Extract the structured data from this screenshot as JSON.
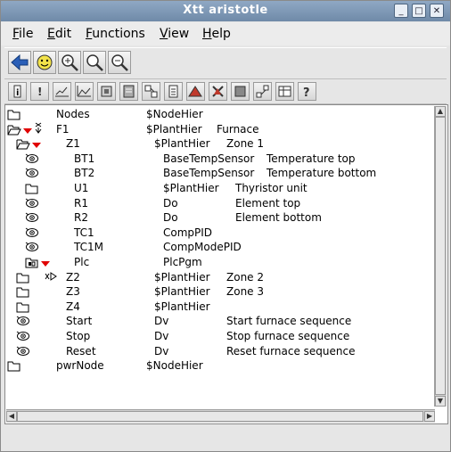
{
  "window": {
    "title": "Xtt aristotle"
  },
  "titlebar_buttons": [
    "minimize-icon",
    "maximize-icon",
    "close-icon"
  ],
  "menu": [
    {
      "label": "File",
      "mnemonic": "F",
      "rest": "ile"
    },
    {
      "label": "Edit",
      "mnemonic": "E",
      "rest": "dit"
    },
    {
      "label": "Functions",
      "mnemonic": "F",
      "rest": "unctions"
    },
    {
      "label": "View",
      "mnemonic": "V",
      "rest": "iew"
    },
    {
      "label": "Help",
      "mnemonic": "H",
      "rest": "elp"
    }
  ],
  "toolbar1": [
    "back-arrow-icon",
    "smiley-icon",
    "zoom-in-icon",
    "zoom-reset-icon",
    "zoom-out-icon"
  ],
  "toolbar2": [
    "info-icon",
    "alarm-icon",
    "trend-icon",
    "graph-icon",
    "object-graph-icon",
    "datasheet-icon",
    "crossref-icon",
    "document-icon",
    "triangle-icon",
    "block-icon",
    "collapse-icon",
    "hierarchy-icon",
    "table-icon",
    "help-icon"
  ],
  "colors": {
    "marker": "#e00000",
    "folder": "#000000",
    "titlebar": "#7b94b2"
  },
  "tree": [
    {
      "name": "Nodes",
      "class": "$NodeHier",
      "desc": "",
      "icon": "folder",
      "marker": false
    },
    {
      "name": "F1",
      "class": "$PlantHier",
      "desc": "Furnace",
      "icon": "folder-open",
      "marker": true
    },
    {
      "name": "Z1",
      "class": "$PlantHier",
      "desc": "Zone 1",
      "icon": "folder-open",
      "marker": true
    },
    {
      "name": "BT1",
      "class": "BaseTempSensor",
      "desc": "Temperature top",
      "icon": "object",
      "marker": false
    },
    {
      "name": "BT2",
      "class": "BaseTempSensor",
      "desc": "Temperature bottom",
      "icon": "object",
      "marker": false
    },
    {
      "name": "U1",
      "class": "$PlantHier",
      "desc": "Thyristor unit",
      "icon": "folder",
      "marker": false
    },
    {
      "name": "R1",
      "class": "Do",
      "desc": "Element top",
      "icon": "object",
      "marker": false
    },
    {
      "name": "R2",
      "class": "Do",
      "desc": "Element bottom",
      "icon": "object",
      "marker": false
    },
    {
      "name": "TC1",
      "class": "CompPID",
      "desc": "",
      "icon": "object",
      "marker": false
    },
    {
      "name": "TC1M",
      "class": "CompModePID",
      "desc": "",
      "icon": "object",
      "marker": false
    },
    {
      "name": "Plc",
      "class": "PlcPgm",
      "desc": "",
      "icon": "plc",
      "marker": true
    },
    {
      "name": "Z2",
      "class": "$PlantHier",
      "desc": "Zone 2",
      "icon": "folder",
      "marker": false
    },
    {
      "name": "Z3",
      "class": "$PlantHier",
      "desc": "Zone 3",
      "icon": "folder",
      "marker": false
    },
    {
      "name": "Z4",
      "class": "$PlantHier",
      "desc": "",
      "icon": "folder",
      "marker": false
    },
    {
      "name": "Start",
      "class": "Dv",
      "desc": "Start furnace sequence",
      "icon": "object",
      "marker": false
    },
    {
      "name": "Stop",
      "class": "Dv",
      "desc": "Stop furnace sequence",
      "icon": "object",
      "marker": false
    },
    {
      "name": "Reset",
      "class": "Dv",
      "desc": "Reset furnace sequence",
      "icon": "object",
      "marker": false
    },
    {
      "name": "pwrNode",
      "class": "$NodeHier",
      "desc": "",
      "icon": "folder",
      "marker": false
    }
  ]
}
